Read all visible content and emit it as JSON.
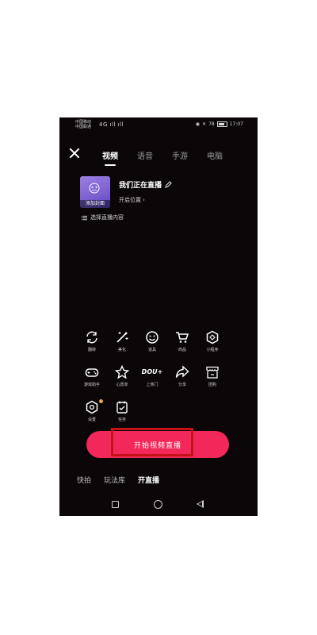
{
  "status_bar": {
    "carrier_line1": "中国移动",
    "carrier_line2": "中国联通",
    "signal": "4G ıll ıll",
    "battery_pct": "78",
    "time": "17:07"
  },
  "tabs": [
    {
      "label": "视频",
      "active": true
    },
    {
      "label": "语音",
      "active": false
    },
    {
      "label": "手游",
      "active": false
    },
    {
      "label": "电脑",
      "active": false
    }
  ],
  "profile": {
    "cover_caption": "添加封面",
    "title": "我们正在直播",
    "location": "开启位置",
    "topic": "选择直播内容"
  },
  "tools": [
    {
      "label": "翻转",
      "icon": "flip-camera-icon"
    },
    {
      "label": "美化",
      "icon": "magic-wand-icon"
    },
    {
      "label": "道具",
      "icon": "smile-icon"
    },
    {
      "label": "商品",
      "icon": "cart-icon"
    },
    {
      "label": "小程序",
      "icon": "mini-program-icon"
    },
    {
      "label": "游戏助手",
      "icon": "gamepad-icon"
    },
    {
      "label": "心愿单",
      "icon": "star-icon"
    },
    {
      "label": "上热门",
      "icon": "dou-plus-icon",
      "glyph": "DOU+"
    },
    {
      "label": "分享",
      "icon": "share-icon"
    },
    {
      "label": "团购",
      "icon": "shop-icon"
    },
    {
      "label": "设置",
      "icon": "settings-icon"
    },
    {
      "label": "任务",
      "icon": "task-icon"
    }
  ],
  "start_button": {
    "label": "开始视频直播"
  },
  "bottom_tabs": [
    {
      "label": "快拍",
      "active": false
    },
    {
      "label": "玩法库",
      "active": false
    },
    {
      "label": "开直播",
      "active": true
    }
  ],
  "colors": {
    "accent": "#f2285a",
    "highlight": "#c4121b",
    "background": "#0b0709",
    "dot": "#f3a23c"
  }
}
